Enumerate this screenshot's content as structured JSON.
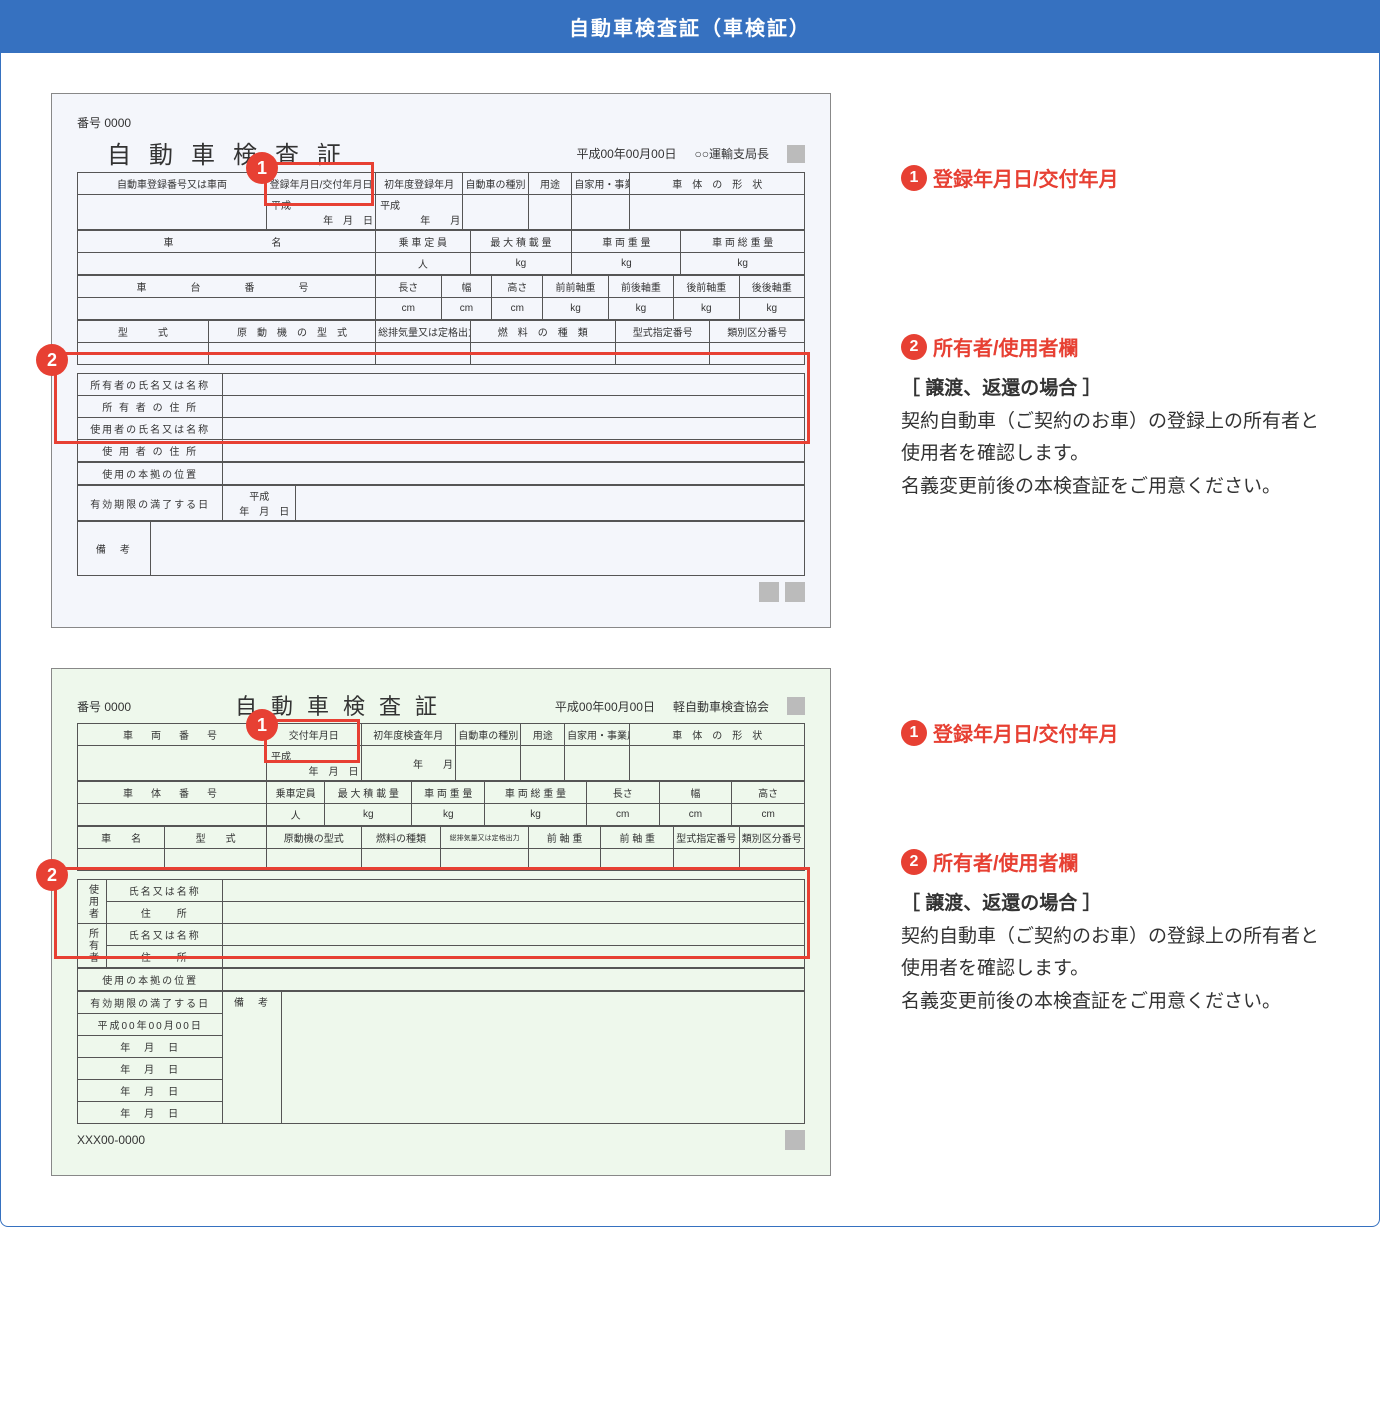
{
  "banner_title": "自動車検査証（車検証）",
  "cert1": {
    "number_label": "番号",
    "number": "0000",
    "date": "平成00年00月00日",
    "issuer": "○○運輸支局長",
    "title": "自動車検査証",
    "r1": {
      "c1": "自動車登録番号又は車両",
      "c2": "登録年月日/交付年月日",
      "c3": "初年度登録年月",
      "c4": "自動車の種別",
      "c5": "用途",
      "c6": "自家用・事業用の別",
      "c7": "車　体　の　形　状"
    },
    "r1v": {
      "c2a": "平成",
      "c2b": "年　月　日",
      "c3a": "平成",
      "c3b": "年　　月"
    },
    "r2": {
      "c1": "車　　　　　名",
      "c2": "乗 車 定 員",
      "c3": "最 大 積 載 量",
      "c4": "車 両 重 量",
      "c5": "車 両 総 重 量"
    },
    "r2u": {
      "u1": "人",
      "u2": "kg",
      "u3": "kg",
      "u4": "kg"
    },
    "r3": {
      "c1": "車　　台　　番　　号",
      "c2": "長さ",
      "c3": "幅",
      "c4": "高さ",
      "c5": "前前軸重",
      "c6": "前後軸重",
      "c7": "後前軸重",
      "c8": "後後軸重"
    },
    "r3u": {
      "u": "cm",
      "u2": "kg"
    },
    "r4": {
      "c1": "型　　　式",
      "c2": "原　動　機　の　型　式",
      "c3": "総排気量又は定格出力",
      "c4": "燃　料　の　種　類",
      "c5": "型式指定番号",
      "c6": "類別区分番号"
    },
    "owner": {
      "l1": "所有者の氏名又は名称",
      "l2": "所 有 者 の 住 所",
      "l3": "使用者の氏名又は名称",
      "l4": "使 用 者 の 住 所",
      "l5": "使用の本拠の位置",
      "l6": "有効期限の満了する日",
      "l6v": "平成\n　年　月　日",
      "l7": "備　考"
    }
  },
  "cert2": {
    "number_label": "番号",
    "number": "0000",
    "date": "平成00年00月00日",
    "issuer": "軽自動車検査協会",
    "title": "自動車検査証",
    "r1": {
      "c1": "車　両　番　号",
      "c2": "交付年月日",
      "c3": "初年度検査年月",
      "c4": "自動車の種別",
      "c5": "用途",
      "c6": "自家用・事業用の別",
      "c7": "車　体　の　形　状"
    },
    "r1v": {
      "c2a": "平成",
      "c2b": "年　月　日",
      "c3b": "年　　月"
    },
    "r2": {
      "c1": "車　体　番　号",
      "c2": "乗車定員",
      "c3": "最 大 積 載 量",
      "c4": "車 両 重 量",
      "c5": "車 両 総 重 量",
      "c6": "長さ",
      "c7": "幅",
      "c8": "高さ"
    },
    "r2u": {
      "u1": "人",
      "u2": "kg",
      "u3": "cm"
    },
    "r3": {
      "c1": "車　　名",
      "c2": "型　　式",
      "c3": "原動機の型式",
      "c4": "燃料の種類",
      "c5": "総排気量又は定格出力",
      "c6": "前 軸 重",
      "c7": "前 軸 重",
      "c8": "型式指定番号",
      "c9": "類別区分番号"
    },
    "owner": {
      "grp1": "使用者",
      "grp2": "所有者",
      "l1": "氏名又は名称",
      "l2": "住　　所",
      "l5": "使用の本拠の位置",
      "l6": "有効期限の満了する日",
      "l6v": "平成00年00月00日",
      "dr": "年　月　日",
      "l7": "備　考"
    },
    "footer": "XXX00-0000"
  },
  "annotations": {
    "n1": "1",
    "n2": "2",
    "a1_title": "登録年月日/交付年月",
    "a2_title": "所有者/使用者欄",
    "a2_sub": "［ 譲渡、返還の場合 ］",
    "a2_body": "契約自動車（ご契約のお車）の登録上の所有者と使用者を確認します。\n名義変更前後の本検査証をご用意ください。"
  }
}
